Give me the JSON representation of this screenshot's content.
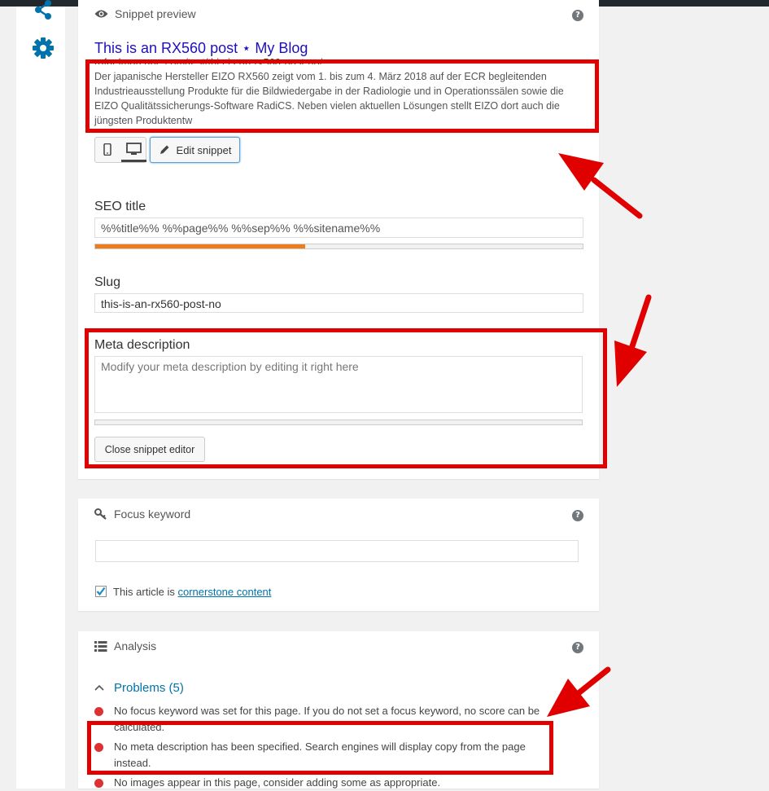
{
  "colors": {
    "accent_orange": "#ee7c1b",
    "link_blue": "#0073aa",
    "annotation_red": "#e00000",
    "problem_red": "#dc3232",
    "title_blue": "#1e0fbe"
  },
  "nav": {
    "icons": [
      "share-icon",
      "gear-icon"
    ]
  },
  "snippet": {
    "header": "Snippet preview",
    "title": "This is an RX560 post ⋆ My Blog",
    "url": "rafaelmarcane.com/test/this-is-an-rx560-post-no/",
    "description": "Der japanische Hersteller EIZO RX560 zeigt vom 1. bis zum 4. März 2018 auf der ECR begleitenden Industrieausstellung Produkte für die Bildwiedergabe in der Radiologie und in Operationssälen sowie die EIZO Qualitätssicherungs-Software RadiCS. Neben vielen aktuellen Lösungen stellt EIZO dort auch die jüngsten Produktentw",
    "edit_button": "Edit snippet",
    "help": "?"
  },
  "editor": {
    "seo_title_label": "SEO title",
    "seo_title_value": "%%title%% %%page%% %%sep%% %%sitename%%",
    "seo_progress": 0.43,
    "slug_label": "Slug",
    "slug_value": "this-is-an-rx560-post-no",
    "meta_label": "Meta description",
    "meta_placeholder": "Modify your meta description by editing it right here",
    "meta_progress": 0,
    "close_button": "Close snippet editor"
  },
  "focus": {
    "header": "Focus keyword",
    "keyword_value": "",
    "cornerstone_checked": true,
    "cornerstone_prefix": "This article is",
    "cornerstone_link": "cornerstone content",
    "help": "?"
  },
  "analysis": {
    "header": "Analysis",
    "problems_label": "Problems (5)",
    "problems": [
      "No focus keyword was set for this page. If you do not set a focus keyword, no score can be calculated.",
      "No meta description has been specified. Search engines will display copy from the page instead.",
      "No images appear in this page, consider adding some as appropriate."
    ],
    "help": "?"
  }
}
